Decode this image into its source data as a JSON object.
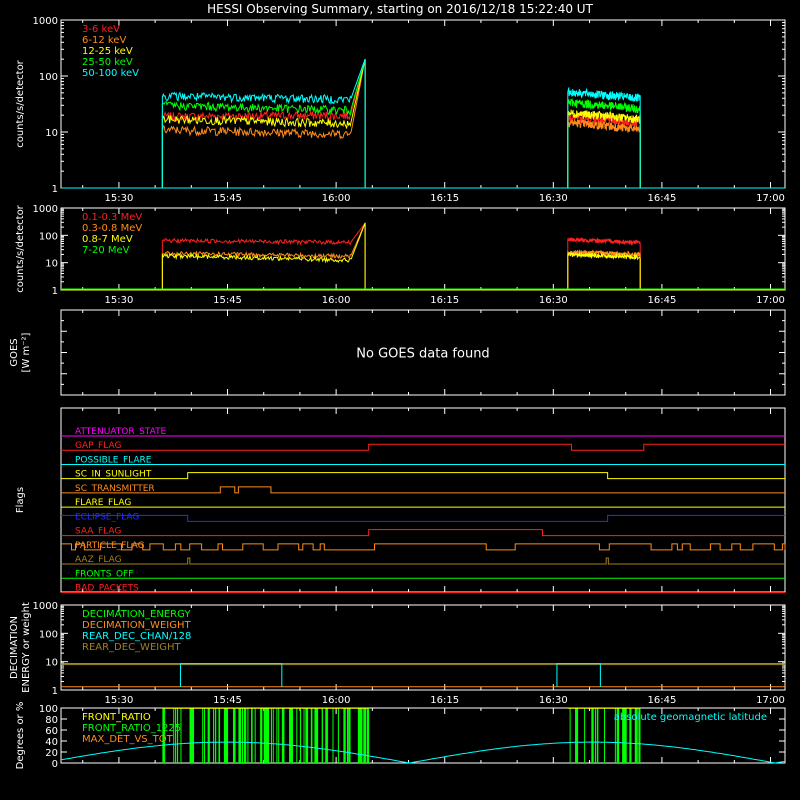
{
  "title": "HESSI Observing Summary, starting on 2016/12/18 15:22:40 UT",
  "time_axis": {
    "start": "15:20",
    "end": "17:02",
    "ticks": [
      "15:30",
      "15:45",
      "16:00",
      "16:15",
      "16:30",
      "16:45",
      "17:00"
    ],
    "tick_minutes": [
      30,
      45,
      60,
      75,
      90,
      105,
      120
    ]
  },
  "chart_data": [
    {
      "id": "p1",
      "type": "line",
      "ylabel": "counts/s/detector",
      "yscale": "log",
      "ylim": [
        1,
        1000
      ],
      "yticks": [
        "1",
        "10",
        "100",
        "1000"
      ],
      "x_unit": "minutes after 15:00",
      "series": [
        {
          "name": "3-6 keV",
          "color": "#ff2020",
          "segments": [
            [
              36,
              64,
              19,
              20,
              "ramp"
            ],
            [
              92,
              102,
              18,
              15,
              "flat"
            ]
          ]
        },
        {
          "name": "6-12 keV",
          "color": "#ff8c1a",
          "segments": [
            [
              36,
              64,
              11,
              9,
              "ramp"
            ],
            [
              92,
              102,
              15,
              11,
              "flat"
            ]
          ]
        },
        {
          "name": "12-25 keV",
          "color": "#ffff00",
          "segments": [
            [
              36,
              64,
              17,
              14,
              "ramp"
            ],
            [
              92,
              102,
              22,
              17,
              "flat"
            ]
          ]
        },
        {
          "name": "25-50 keV",
          "color": "#00ff00",
          "segments": [
            [
              36,
              64,
              30,
              24,
              "ramp"
            ],
            [
              92,
              102,
              34,
              26,
              "flat"
            ]
          ]
        },
        {
          "name": "50-100 keV",
          "color": "#00ffff",
          "segments": [
            [
              36,
              64,
              44,
              38,
              "ramp"
            ],
            [
              92,
              102,
              52,
              40,
              "flat"
            ]
          ]
        }
      ],
      "ramp_peak": 200
    },
    {
      "id": "p2",
      "type": "line",
      "ylabel": "counts/s/detector",
      "yscale": "log",
      "ylim": [
        1,
        1000
      ],
      "yticks": [
        "1",
        "10",
        "100",
        "1000"
      ],
      "series": [
        {
          "name": "0.1-0.3 MeV",
          "color": "#ff2020",
          "segments": [
            [
              36,
              64,
              65,
              55,
              "ramp"
            ],
            [
              92,
              102,
              70,
              55,
              "flat"
            ]
          ]
        },
        {
          "name": "0.3-0.8 MeV",
          "color": "#ff8c1a",
          "segments": [
            [
              36,
              64,
              22,
              17,
              "ramp"
            ],
            [
              92,
              102,
              25,
              20,
              "flat"
            ]
          ]
        },
        {
          "name": "0.8-7 MeV",
          "color": "#ffff00",
          "segments": [
            [
              36,
              64,
              18,
              12,
              "ramp"
            ],
            [
              92,
              102,
              20,
              16,
              "flat"
            ]
          ]
        },
        {
          "name": "7-20 MeV",
          "color": "#00ff00",
          "segments": []
        }
      ],
      "ramp_peak": 280
    },
    {
      "id": "p3",
      "type": "line",
      "ylabel": "GOES",
      "ylabel2": "[W m⁻²]",
      "message": "No GOES data found"
    },
    {
      "id": "p4",
      "type": "line",
      "ylabel": "Flags",
      "flags": [
        {
          "name": "ATTENUATOR_STATE",
          "color": "#ff00ff",
          "changes": []
        },
        {
          "name": "GAP_FLAG",
          "color": "#ff2020",
          "changes": [
            [
              64.5,
              1
            ],
            [
              92.5,
              0
            ],
            [
              102.5,
              1
            ]
          ]
        },
        {
          "name": "POSSIBLE_FLARE",
          "color": "#00ffff",
          "changes": []
        },
        {
          "name": "SC_IN_SUNLIGHT",
          "color": "#ffff00",
          "changes": [
            [
              39.5,
              1
            ],
            [
              97.5,
              0
            ]
          ]
        },
        {
          "name": "SC_TRANSMITTER",
          "color": "#ff8c1a",
          "changes": [
            [
              44,
              1
            ],
            [
              46,
              0
            ],
            [
              46.5,
              1
            ],
            [
              51,
              0
            ]
          ]
        },
        {
          "name": "FLARE_FLAG",
          "color": "#ffff00",
          "changes": []
        },
        {
          "name": "ECLIPSE_FLAG",
          "color": "#2030ff",
          "changes": [
            [
              39.5,
              0
            ],
            [
              97.5,
              1
            ]
          ]
        },
        {
          "name": "SAA_FLAG",
          "color": "#ff2020",
          "changes": [
            [
              64.5,
              1
            ],
            [
              88.5,
              0
            ]
          ]
        },
        {
          "name": "PARTICLE_FLAG",
          "color": "#ff8c1a",
          "changes": "noisy"
        },
        {
          "name": "AAZ_FLAG",
          "color": "#a08020",
          "changes": "spikes"
        },
        {
          "name": "FRONTS_OFF",
          "color": "#00ff00",
          "changes": []
        },
        {
          "name": "BAD_PACKETS",
          "color": "#ff2020",
          "changes": []
        }
      ]
    },
    {
      "id": "p5",
      "type": "line",
      "ylabel": "DECIMATION",
      "ylabel2": "ENERGY or weight",
      "yscale": "log",
      "ylim": [
        1,
        1000
      ],
      "yticks": [
        "1",
        "10",
        "100",
        "1000"
      ],
      "series": [
        {
          "name": "DECIMATION_ENERGY",
          "color": "#00ff00",
          "values": "flat 8"
        },
        {
          "name": "DECIMATION_WEIGHT",
          "color": "#ff8c1a",
          "values": "flat 1.3"
        },
        {
          "name": "REAR_DEC_CHAN/128",
          "color": "#00ffff",
          "values": "box 8 on 38.5-52.5 and 90.5-96.5"
        },
        {
          "name": "REAR_DEC_WEIGHT",
          "color": "#a08020",
          "values": "flat 8"
        }
      ]
    },
    {
      "id": "p6",
      "type": "line",
      "ylabel": "Degrees or %",
      "ylim": [
        0,
        100
      ],
      "yticks": [
        "0",
        "20",
        "40",
        "60",
        "80",
        "100"
      ],
      "series": [
        {
          "name": "FRONT_RATIO",
          "color": "#ffff00"
        },
        {
          "name": "FRONT_RATIO_1225",
          "color": "#00ff00"
        },
        {
          "name": "MAX_DET_VS_TOT",
          "color": "#ff8c1a"
        }
      ],
      "right_label": "absolute geomagnetic latitude",
      "right_label_color": "#00ffff"
    }
  ]
}
